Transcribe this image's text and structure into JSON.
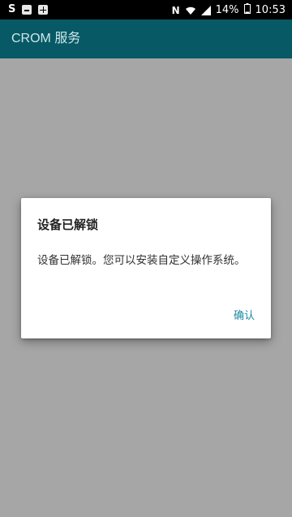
{
  "status_bar": {
    "left_icons": [
      "s-icon",
      "face-notification-icon",
      "grid-notification-icon"
    ],
    "s_label": "S",
    "nfc_label": "N",
    "battery": "14%",
    "time": "10:53"
  },
  "app_bar": {
    "title": "CROM 服务",
    "color": "#0a7b8c"
  },
  "dialog": {
    "title": "设备已解锁",
    "message": "设备已解锁。您可以安装自定义操作系统。",
    "confirm_label": "确认",
    "accent_color": "#1b8ba0"
  }
}
